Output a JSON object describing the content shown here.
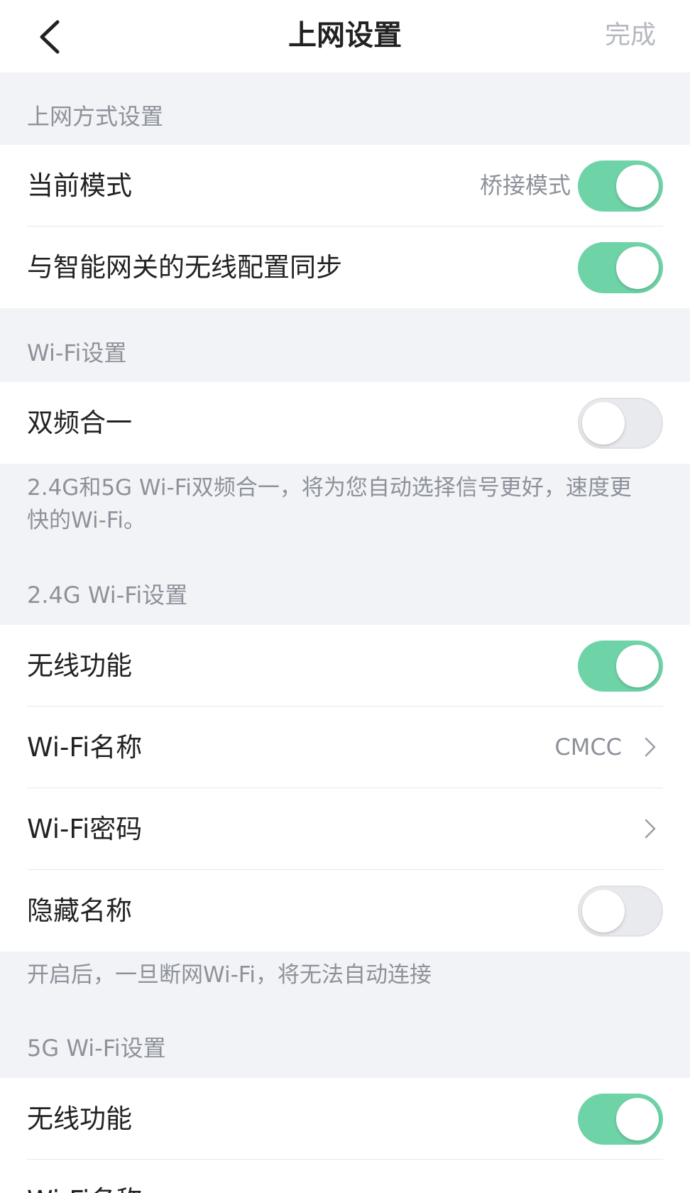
{
  "nav": {
    "title": "上网设置",
    "done_label": "完成",
    "back_icon": "chevron-left-icon"
  },
  "colors": {
    "accent_green": "#6fd3a8",
    "background": "#f1f3f7",
    "muted_text": "#8d9199"
  },
  "internet_mode_section": {
    "header": "上网方式设置",
    "current_mode": {
      "label": "当前模式",
      "value": "桥接模式",
      "toggle_on": true
    },
    "sync_with_gateway": {
      "label": "与智能网关的无线配置同步",
      "toggle_on": true
    }
  },
  "wifi_section": {
    "header": "Wi-Fi设置",
    "dual_band": {
      "label": "双频合一",
      "toggle_on": false
    },
    "note": "2.4G和5G Wi-Fi双频合一，将为您自动选择信号更好，速度更快的Wi-Fi。"
  },
  "wifi_24g_section": {
    "header": "2.4G Wi-Fi设置",
    "wireless": {
      "label": "无线功能",
      "toggle_on": true
    },
    "ssid": {
      "label": "Wi-Fi名称",
      "value": "CMCC"
    },
    "password": {
      "label": "Wi-Fi密码"
    },
    "hide_ssid": {
      "label": "隐藏名称",
      "toggle_on": false
    },
    "note": "开启后，一旦断网Wi-Fi，将无法自动连接"
  },
  "wifi_5g_section": {
    "header": "5G Wi-Fi设置",
    "wireless": {
      "label": "无线功能",
      "toggle_on": true
    },
    "ssid": {
      "label": "Wi-Fi名称"
    }
  }
}
